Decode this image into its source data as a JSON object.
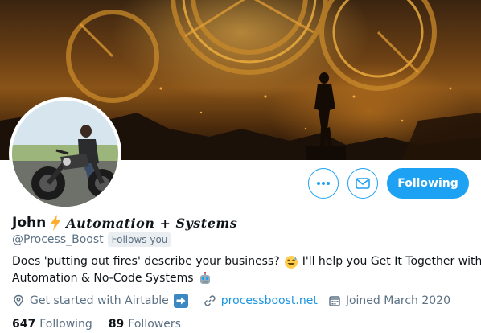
{
  "profile": {
    "name": "John",
    "name_tag": "Automation + Systems",
    "handle": "@Process_Boost",
    "follows_you": "Follows you",
    "bio_line1_a": "Does 'putting out fires' describe your business?",
    "bio_line1_b": "I'll help you Get It Together with",
    "bio_line2": "Automation & No-Code Systems",
    "location": "Get started with Airtable",
    "website": "processboost.net",
    "joined": "Joined March 2020",
    "following_count": "647",
    "following_label": "Following",
    "followers_count": "89",
    "followers_label": "Followers"
  },
  "actions": {
    "following_button": "Following"
  },
  "icons": {
    "more": "more-icon",
    "message": "envelope-icon",
    "location": "location-pin-icon",
    "link": "link-icon",
    "calendar": "calendar-icon",
    "bolt": "lightning-bolt-icon",
    "sweat_smile": "sweat-smile-emoji",
    "robot": "robot-emoji",
    "arrow": "right-arrow-emoji"
  },
  "colors": {
    "accent": "#1da1f2",
    "link": "#1b95e0",
    "secondary_text": "#5b7083"
  }
}
